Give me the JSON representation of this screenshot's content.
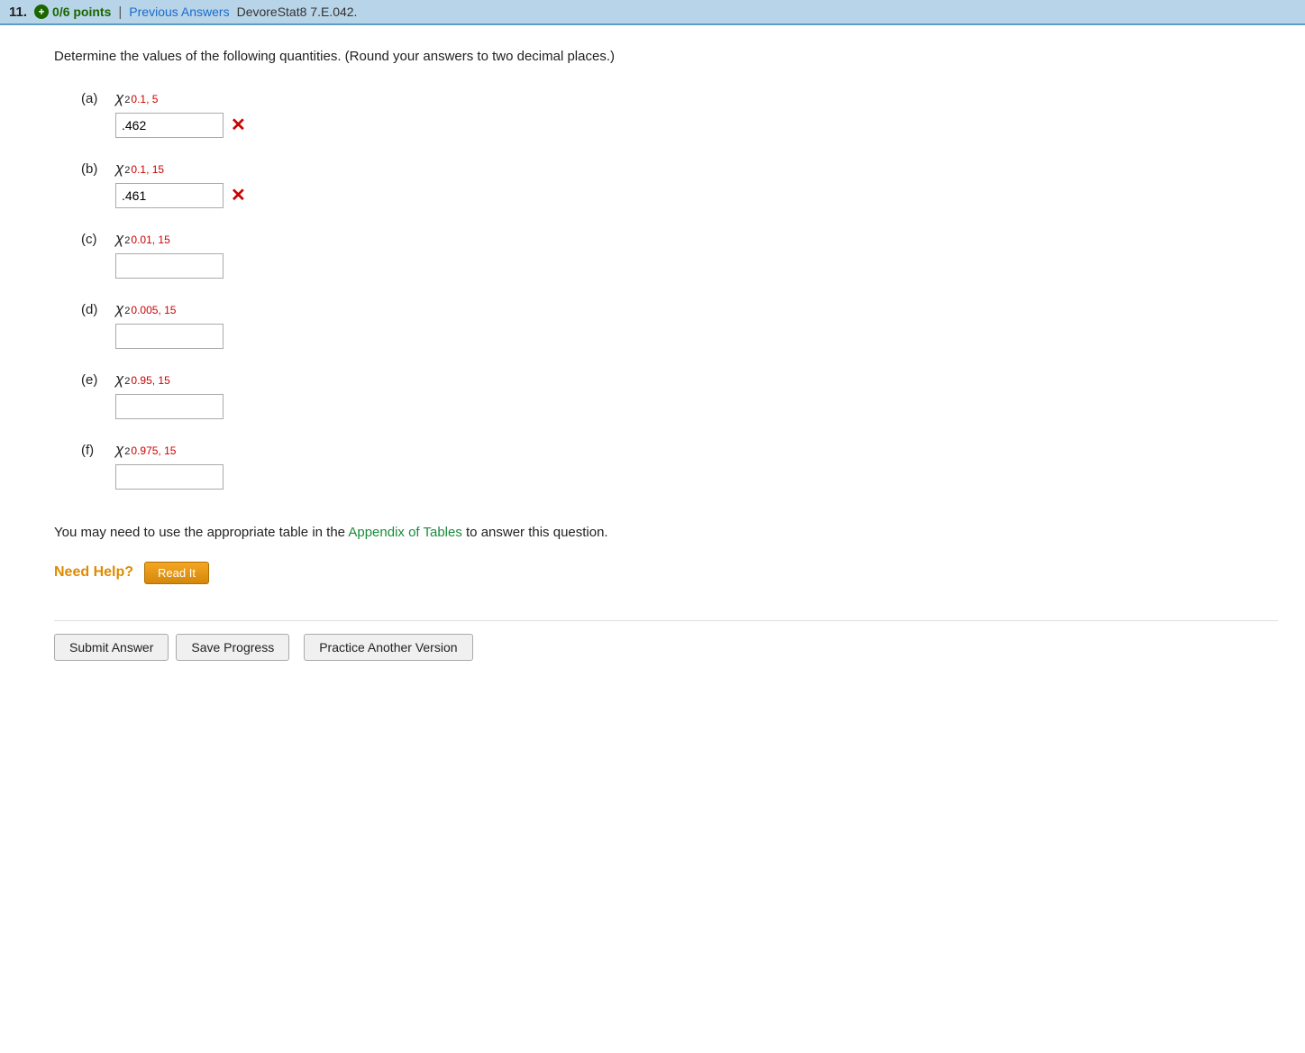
{
  "header": {
    "question_number": "11.",
    "points": "0/6 points",
    "prev_answers_label": "Previous Answers",
    "source": "DevoreStat8 7.E.042."
  },
  "question": {
    "text": "Determine the values of the following quantities. (Round your answers to two decimal places.)"
  },
  "parts": [
    {
      "letter": "(a)",
      "chi_subscript": "0.1, 5",
      "value": ".462",
      "wrong": true,
      "empty": false
    },
    {
      "letter": "(b)",
      "chi_subscript": "0.1, 15",
      "value": ".461",
      "wrong": true,
      "empty": false
    },
    {
      "letter": "(c)",
      "chi_subscript": "0.01, 15",
      "value": "",
      "wrong": false,
      "empty": true
    },
    {
      "letter": "(d)",
      "chi_subscript": "0.005, 15",
      "value": "",
      "wrong": false,
      "empty": true
    },
    {
      "letter": "(e)",
      "chi_subscript": "0.95, 15",
      "value": "",
      "wrong": false,
      "empty": true
    },
    {
      "letter": "(f)",
      "chi_subscript": "0.975, 15",
      "value": "",
      "wrong": false,
      "empty": true
    }
  ],
  "chi_subs": [
    {
      "alpha": "0.1",
      "df": "5"
    },
    {
      "alpha": "0.1",
      "df": "15"
    },
    {
      "alpha": "0.01",
      "df": "15"
    },
    {
      "alpha": "0.005",
      "df": "15"
    },
    {
      "alpha": "0.95",
      "df": "15"
    },
    {
      "alpha": "0.975",
      "df": "15"
    }
  ],
  "footnote": {
    "text_before": "You may need to use the appropriate table in the ",
    "link_text": "Appendix of Tables",
    "text_after": " to answer this question."
  },
  "need_help": {
    "label": "Need Help?",
    "read_it_label": "Read It"
  },
  "buttons": {
    "submit": "Submit Answer",
    "save": "Save Progress",
    "practice": "Practice Another Version"
  }
}
